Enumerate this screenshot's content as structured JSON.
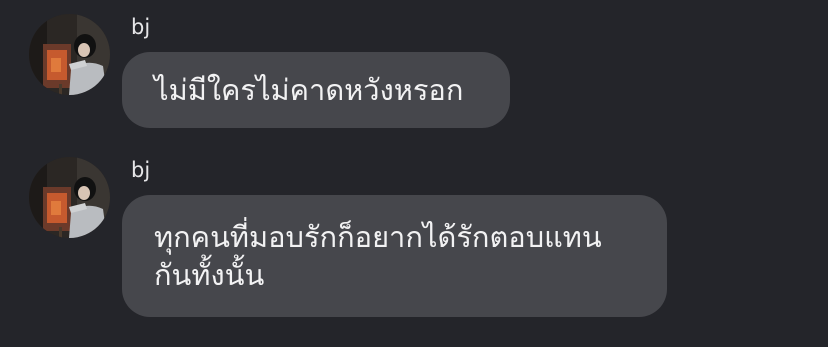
{
  "messages": [
    {
      "sender": "bj",
      "text": "ไม่มีใครไม่คาดหวังหรอก"
    },
    {
      "sender": "bj",
      "text": "ทุกคนที่มอบรักก็อยากได้รักตอบแทน กันทั้งนั้น"
    }
  ],
  "colors": {
    "background": "#24252a",
    "bubble": "#46474c",
    "text": "#f2f2f3",
    "sender": "#e6e6e8"
  }
}
